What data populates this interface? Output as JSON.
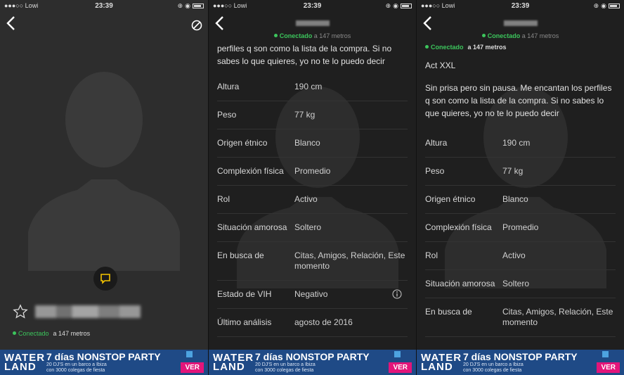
{
  "status_bar": {
    "carrier": "●●●○○ Lowi",
    "time": "23:39"
  },
  "profile": {
    "online_label": "Conectado",
    "distance": "a 147 metros",
    "headline": "Act XXL",
    "bio_full": "Sin prisa pero sin pausa. Me encantan los perfiles q son como la lista de la compra. Si no sabes lo que quieres, yo no te lo puedo decir",
    "bio_tail": "perfiles q son como la lista de la compra. Si no sabes lo que quieres, yo no te lo puedo decir"
  },
  "details": [
    {
      "label": "Altura",
      "value": "190 cm"
    },
    {
      "label": "Peso",
      "value": "77 kg"
    },
    {
      "label": "Origen étnico",
      "value": "Blanco"
    },
    {
      "label": "Complexión física",
      "value": "Promedio"
    },
    {
      "label": "Rol",
      "value": "Activo"
    },
    {
      "label": "Situación amorosa",
      "value": "Soltero"
    },
    {
      "label": "En busca de",
      "value": "Citas, Amigos, Relación, Este momento"
    },
    {
      "label": "Estado de VIH",
      "value": "Negativo"
    },
    {
      "label": "Último análisis",
      "value": "agosto de 2016"
    }
  ],
  "ad": {
    "logo_line1": "WATER",
    "logo_line2": "LAND",
    "headline": "7 días NONSTOP PARTY",
    "sub1": "20 DJ'S en un barco a Ibiza",
    "sub2": "con 3000 colegas de fiesta",
    "cta": "VER"
  },
  "colors": {
    "online_green": "#3cc55c",
    "accent_yellow": "#f5c400",
    "ad_blue": "#1f4a86",
    "ad_pink": "#e3157a"
  }
}
